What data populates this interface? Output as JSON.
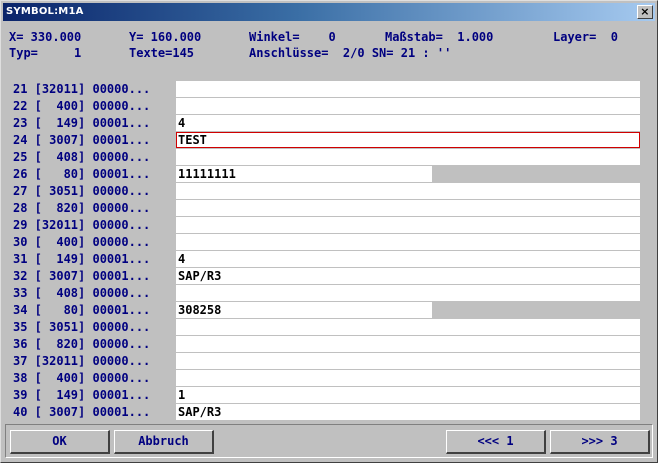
{
  "window": {
    "title": "SYMBOL:M1A",
    "close_label": "×"
  },
  "info": {
    "x": "X= 330.000",
    "y": "Y= 160.000",
    "winkel": "Winkel=    0",
    "massstab": "Maßstab=  1.000",
    "layer": "Layer=  0",
    "typ": "Typ=     1",
    "texte": "Texte=145",
    "anschluesse": "Anschlüsse=  2/0 SN= 21 : ''"
  },
  "rows": [
    {
      "label": "21 [32011] 00000...",
      "value": ""
    },
    {
      "label": "22 [  400] 00000...",
      "value": ""
    },
    {
      "label": "23 [  149] 00001...",
      "value": "4"
    },
    {
      "label": "24 [ 3007] 00001...",
      "value": "TEST"
    },
    {
      "label": "25 [  408] 00000...",
      "value": ""
    },
    {
      "label": "26 [   80] 00001...",
      "value": "11111111"
    },
    {
      "label": "27 [ 3051] 00000...",
      "value": ""
    },
    {
      "label": "28 [  820] 00000...",
      "value": ""
    },
    {
      "label": "29 [32011] 00000...",
      "value": ""
    },
    {
      "label": "30 [  400] 00000...",
      "value": ""
    },
    {
      "label": "31 [  149] 00001...",
      "value": "4"
    },
    {
      "label": "32 [ 3007] 00001...",
      "value": "SAP/R3"
    },
    {
      "label": "33 [  408] 00000...",
      "value": ""
    },
    {
      "label": "34 [   80] 00001...",
      "value": "308258"
    },
    {
      "label": "35 [ 3051] 00000...",
      "value": ""
    },
    {
      "label": "36 [  820] 00000...",
      "value": ""
    },
    {
      "label": "37 [32011] 00000...",
      "value": ""
    },
    {
      "label": "38 [  400] 00000...",
      "value": ""
    },
    {
      "label": "39 [  149] 00001...",
      "value": "1"
    },
    {
      "label": "40 [ 3007] 00001...",
      "value": "SAP/R3"
    }
  ],
  "buttons": {
    "ok": "OK",
    "abbruch": "Abbruch",
    "prev": "<<< 1",
    "next": ">>> 3"
  },
  "colors": {
    "title_gradient_start": "#0a246a",
    "text_blue": "#000080",
    "focus_border": "#d00000",
    "dialog_bg": "#c0c0c0"
  }
}
